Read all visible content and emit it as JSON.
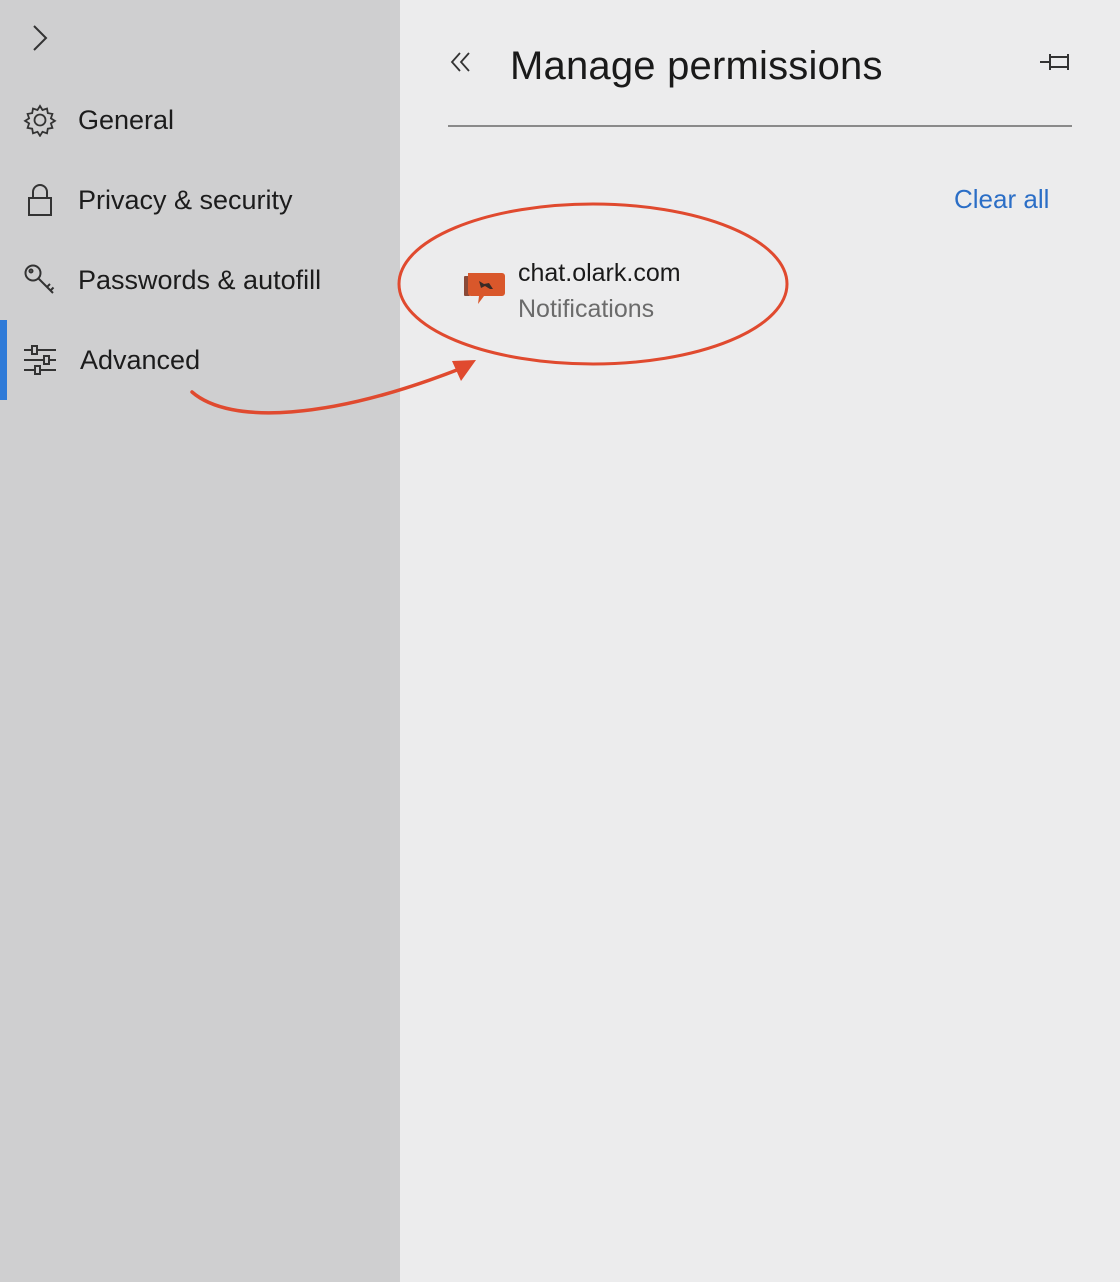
{
  "sidebar": {
    "items": [
      {
        "label": "General",
        "icon": "gear-icon"
      },
      {
        "label": "Privacy & security",
        "icon": "lock-icon"
      },
      {
        "label": "Passwords & autofill",
        "icon": "key-icon"
      },
      {
        "label": "Advanced",
        "icon": "sliders-icon",
        "active": true
      }
    ]
  },
  "panel": {
    "title": "Manage permissions",
    "clear_all": "Clear all",
    "sites": [
      {
        "name": "chat.olark.com",
        "permission": "Notifications",
        "icon": "olark-favicon"
      }
    ]
  },
  "colors": {
    "accent": "#2f7bd8",
    "link": "#2b6ec6",
    "annotation": "#e04a2f",
    "sidebar_bg": "#cfcfd0",
    "panel_bg": "#ececed"
  }
}
